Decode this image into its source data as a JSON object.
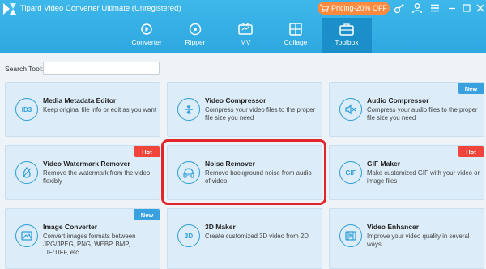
{
  "app": {
    "title": "Tipard Video Converter Ultimate (Unregistered)",
    "pricing_label": "Pricing-20% OFF",
    "accent_color": "#2ea7e0",
    "pricing_color": "#ff8a3d"
  },
  "nav": {
    "tabs": [
      {
        "label": "Converter",
        "icon": "converter-icon"
      },
      {
        "label": "Ripper",
        "icon": "ripper-icon"
      },
      {
        "label": "MV",
        "icon": "mv-icon"
      },
      {
        "label": "Collage",
        "icon": "collage-icon"
      },
      {
        "label": "Toolbox",
        "icon": "toolbox-icon",
        "active": true
      }
    ]
  },
  "search": {
    "label": "Search Tool:",
    "value": ""
  },
  "tools": [
    {
      "title": "Media Metadata Editor",
      "desc": "Keep original file info or edit as you want",
      "icon": "id3-icon",
      "icon_text": "ID3"
    },
    {
      "title": "Video Compressor",
      "desc": "Compress your video files to the proper file size you need",
      "icon": "compress-icon"
    },
    {
      "title": "Audio Compressor",
      "desc": "Compress your audio files to the proper file size you need",
      "icon": "audio-compress-icon",
      "badge": "New"
    },
    {
      "title": "Video Watermark Remover",
      "desc": "Remove the watermark from the video flexibly",
      "icon": "droplet-icon",
      "badge": "Hot"
    },
    {
      "title": "Noise Remover",
      "desc": "Remove background noise from audio of video",
      "icon": "headphones-icon"
    },
    {
      "title": "GIF Maker",
      "desc": "Make customized GIF with your video or image files",
      "icon": "gif-icon",
      "icon_text": "GIF",
      "badge": "Hot"
    },
    {
      "title": "Image Converter",
      "desc": "Convert images formats between JPG/JPEG, PNG, WEBP, BMP, TIF/TIFF, etc.",
      "icon": "image-convert-icon",
      "badge": "New"
    },
    {
      "title": "3D Maker",
      "desc": "Create customized 3D video from 2D",
      "icon": "3d-icon",
      "icon_text": "3D"
    },
    {
      "title": "Video Enhancer",
      "desc": "Improve your video quality in several ways",
      "icon": "enhancer-icon"
    }
  ]
}
